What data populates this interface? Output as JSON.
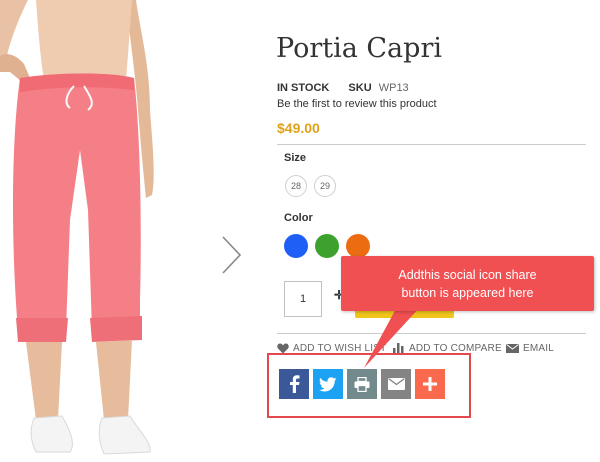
{
  "product": {
    "title": "Portia Capri",
    "stock": "IN STOCK",
    "sku_label": "SKU",
    "sku_value": "WP13",
    "review_link": "Be the first to review this product",
    "price": "$49.00"
  },
  "options": {
    "size_label": "Size",
    "sizes": [
      "28",
      "29"
    ],
    "color_label": "Color",
    "colors": [
      "#1f5ff5",
      "#3da12e",
      "#ec6c12"
    ]
  },
  "cart": {
    "qty_value": "1"
  },
  "actions": {
    "wishlist": "ADD TO WISH LIST",
    "compare": "ADD TO COMPARE",
    "email": "EMAIL"
  },
  "share": {
    "buttons": [
      {
        "icon": "facebook-icon",
        "color": "#3b5998"
      },
      {
        "icon": "twitter-icon",
        "color": "#1da1f2"
      },
      {
        "icon": "print-icon",
        "color": "#738a8d"
      },
      {
        "icon": "email-icon",
        "color": "#848484"
      },
      {
        "icon": "more-icon",
        "color": "#f8694d"
      }
    ]
  },
  "callout": {
    "line1": "Addthis social icon share",
    "line2": "button is appeared here"
  }
}
